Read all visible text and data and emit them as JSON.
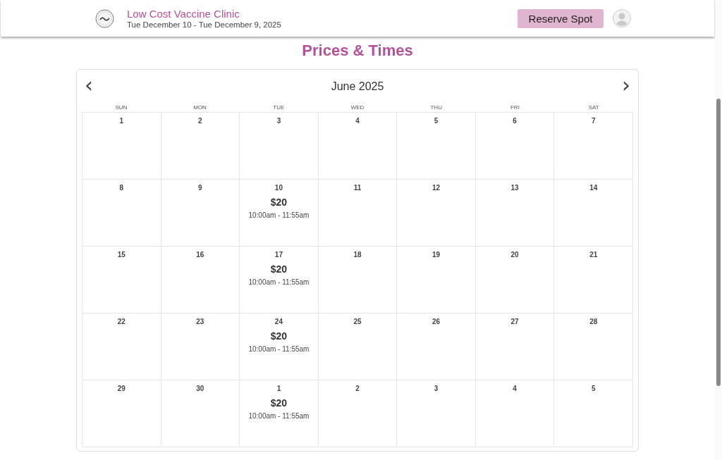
{
  "header": {
    "title": "Low Cost Vaccine Clinic",
    "dates": "Tue December 10 - Tue December 9, 2025",
    "button": "Reserve Spot"
  },
  "heading": "Prices & Times",
  "calendar": {
    "month": "June 2025",
    "prev": "‹",
    "next": "›",
    "weekdays": [
      "SUN",
      "MON",
      "TUE",
      "WED",
      "THU",
      "FRI",
      "SAT"
    ],
    "weeks": [
      [
        {
          "day": "1"
        },
        {
          "day": "2"
        },
        {
          "day": "3"
        },
        {
          "day": "4"
        },
        {
          "day": "5"
        },
        {
          "day": "6"
        },
        {
          "day": "7"
        }
      ],
      [
        {
          "day": "8"
        },
        {
          "day": "9"
        },
        {
          "day": "10",
          "price": "$20",
          "time": "10:00am - 11:55am"
        },
        {
          "day": "11"
        },
        {
          "day": "12"
        },
        {
          "day": "13"
        },
        {
          "day": "14"
        }
      ],
      [
        {
          "day": "15"
        },
        {
          "day": "16"
        },
        {
          "day": "17",
          "price": "$20",
          "time": "10:00am - 11:55am"
        },
        {
          "day": "18"
        },
        {
          "day": "19"
        },
        {
          "day": "20"
        },
        {
          "day": "21"
        }
      ],
      [
        {
          "day": "22"
        },
        {
          "day": "23"
        },
        {
          "day": "24",
          "price": "$20",
          "time": "10:00am - 11:55am"
        },
        {
          "day": "25"
        },
        {
          "day": "26"
        },
        {
          "day": "27"
        },
        {
          "day": "28"
        }
      ],
      [
        {
          "day": "29"
        },
        {
          "day": "30"
        },
        {
          "day": "1",
          "price": "$20",
          "time": "10:00am - 11:55am"
        },
        {
          "day": "2"
        },
        {
          "day": "3"
        },
        {
          "day": "4"
        },
        {
          "day": "5"
        }
      ]
    ]
  }
}
